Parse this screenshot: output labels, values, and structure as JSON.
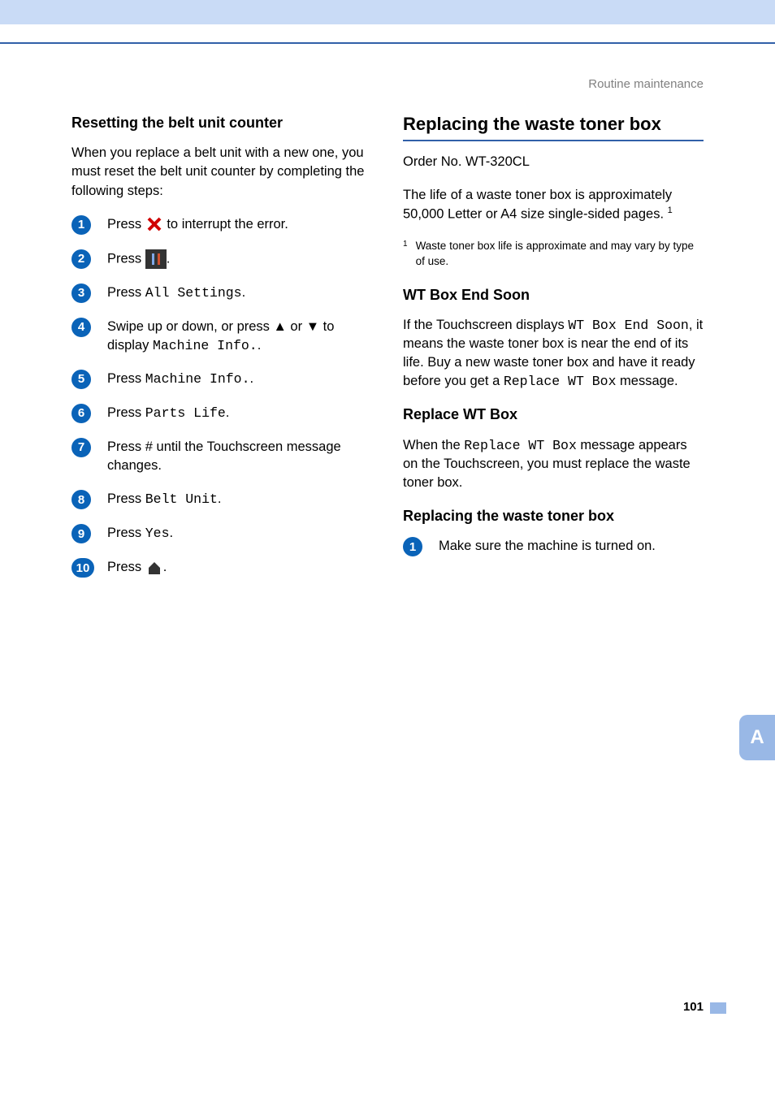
{
  "chapter": "Routine maintenance",
  "left": {
    "heading": "Resetting the belt unit counter",
    "intro": "When you replace a belt unit with a new one, you must reset the belt unit counter by completing the following steps:",
    "steps": {
      "s1a": "Press ",
      "s1b": " to interrupt the error.",
      "s2a": "Press ",
      "s2b": ".",
      "s3a": "Press ",
      "s3mono": "All Settings",
      "s3b": ".",
      "s4a": "Swipe up or down, or press ▲ or ▼ to display ",
      "s4mono": "Machine Info.",
      "s4b": ".",
      "s5a": "Press ",
      "s5mono": "Machine Info.",
      "s5b": ".",
      "s6a": "Press ",
      "s6mono": "Parts Life",
      "s6b": ".",
      "s7": "Press # until the Touchscreen message changes.",
      "s8a": "Press ",
      "s8mono": "Belt Unit",
      "s8b": ".",
      "s9a": "Press ",
      "s9mono": "Yes",
      "s9b": ".",
      "s10a": "Press ",
      "s10b": "."
    },
    "nums": {
      "n1": "1",
      "n2": "2",
      "n3": "3",
      "n4": "4",
      "n5": "5",
      "n6": "6",
      "n7": "7",
      "n8": "8",
      "n9": "9",
      "n10": "10"
    }
  },
  "right": {
    "mainhead": "Replacing the waste toner box",
    "order": "Order No. WT-320CL",
    "life": "The life of a waste toner box is approximately 50,000 Letter or A4 size single-sided pages. ",
    "fn_ref": "1",
    "fn_mark": "1",
    "fn_text": "Waste toner box life is approximate and may vary by type of use.",
    "sec1_head": "WT Box End Soon",
    "sec1_a": "If the Touchscreen displays ",
    "sec1_mono1": "WT Box End Soon",
    "sec1_b": ", it means the waste toner box is near the end of its life. Buy a new waste toner box and have it ready before you get a ",
    "sec1_mono2": "Replace WT Box",
    "sec1_c": " message.",
    "sec2_head": "Replace WT Box",
    "sec2_a": "When the ",
    "sec2_mono": "Replace WT Box",
    "sec2_b": " message appears on the Touchscreen, you must replace the waste toner box.",
    "sec3_head": "Replacing the waste toner box",
    "sec3_step_num": "1",
    "sec3_step": "Make sure the machine is turned on."
  },
  "tab": "A",
  "pagenum": "101"
}
